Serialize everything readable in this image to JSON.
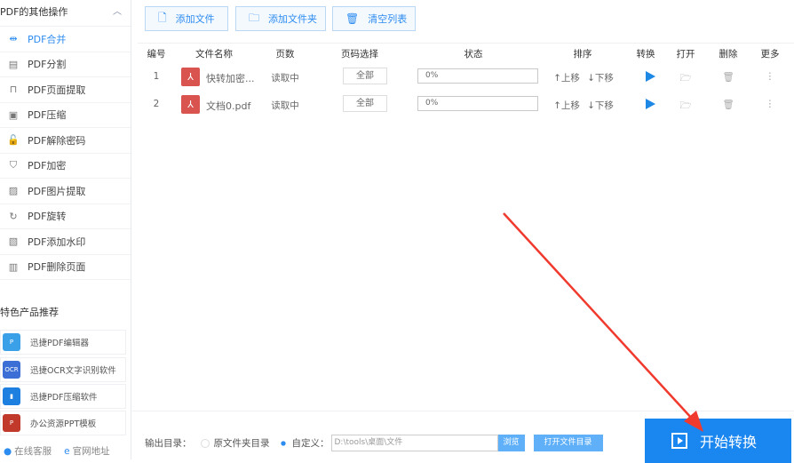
{
  "sidebar": {
    "title": "PDF的其他操作",
    "items": [
      {
        "label": "PDF合并",
        "icon": "merge-icon"
      },
      {
        "label": "PDF分割",
        "icon": "split-icon"
      },
      {
        "label": "PDF页面提取",
        "icon": "extract-icon"
      },
      {
        "label": "PDF压缩",
        "icon": "compress-icon"
      },
      {
        "label": "PDF解除密码",
        "icon": "unlock-icon"
      },
      {
        "label": "PDF加密",
        "icon": "shield-icon"
      },
      {
        "label": "PDF图片提取",
        "icon": "image-icon"
      },
      {
        "label": "PDF旋转",
        "icon": "rotate-icon"
      },
      {
        "label": "PDF添加水印",
        "icon": "watermark-icon"
      },
      {
        "label": "PDF删除页面",
        "icon": "delete-page-icon"
      }
    ],
    "rec_title": "特色产品推荐",
    "products": [
      {
        "label": "迅捷PDF编辑器"
      },
      {
        "label": "迅捷OCR文字识别软件"
      },
      {
        "label": "迅捷PDF压缩软件"
      },
      {
        "label": "办公资源PPT模板"
      }
    ],
    "links": {
      "service": "在线客服",
      "website": "官网地址"
    }
  },
  "toolbar": {
    "add_file": "添加文件",
    "add_folder": "添加文件夹",
    "clear": "清空列表"
  },
  "table": {
    "headers": [
      "编号",
      "文件名称",
      "页数",
      "页码选择",
      "状态",
      "排序",
      "转换",
      "打开",
      "删除",
      "更多"
    ],
    "rows": [
      {
        "num": "1",
        "name": "快转加密...",
        "pages": "读取中",
        "range": "全部",
        "status": "0%",
        "up": "↑上移",
        "down": "↓下移"
      },
      {
        "num": "2",
        "name": "文档0.pdf",
        "pages": "读取中",
        "range": "全部",
        "status": "0%",
        "up": "↑上移",
        "down": "↓下移"
      }
    ]
  },
  "footer": {
    "output_label": "输出目录：",
    "opt_source": "原文件夹目录",
    "opt_custom": "自定义：",
    "path": "D:\\tools\\桌面\\文件",
    "browse": "浏览",
    "open_dir": "打开文件目录",
    "start": "开始转换"
  }
}
